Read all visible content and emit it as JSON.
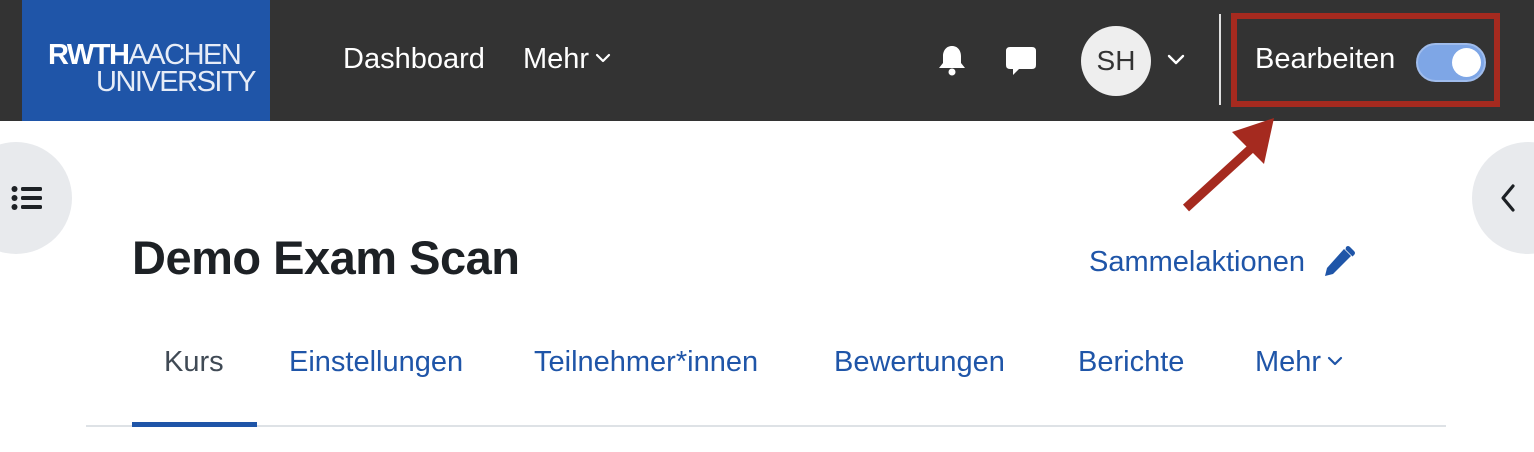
{
  "logo": {
    "line1_bold": "RWTH",
    "line1_thin": "AACHEN",
    "line2": "UNIVERSITY"
  },
  "nav": {
    "dashboard": "Dashboard",
    "more": "Mehr"
  },
  "user": {
    "initials": "SH"
  },
  "edit_mode": {
    "label": "Bearbeiten",
    "enabled": true
  },
  "icons": {
    "notifications": "bell-icon",
    "messages": "chat-icon",
    "course_index": "list-icon",
    "block_drawer": "chevron-left-icon",
    "bulk_edit": "pencil-icon"
  },
  "course": {
    "title": "Demo Exam Scan",
    "bulk_actions": "Sammelaktionen"
  },
  "tabs": [
    {
      "label": "Kurs",
      "active": true
    },
    {
      "label": "Einstellungen",
      "active": false
    },
    {
      "label": "Teilnehmer*innen",
      "active": false
    },
    {
      "label": "Bewertungen",
      "active": false
    },
    {
      "label": "Berichte",
      "active": false
    },
    {
      "label": "Mehr",
      "active": false
    }
  ],
  "colors": {
    "navbar": "#333333",
    "brand_blue": "#1f55a8",
    "annotation_red": "#a52a1f",
    "toggle_on": "#7ea6e6"
  }
}
